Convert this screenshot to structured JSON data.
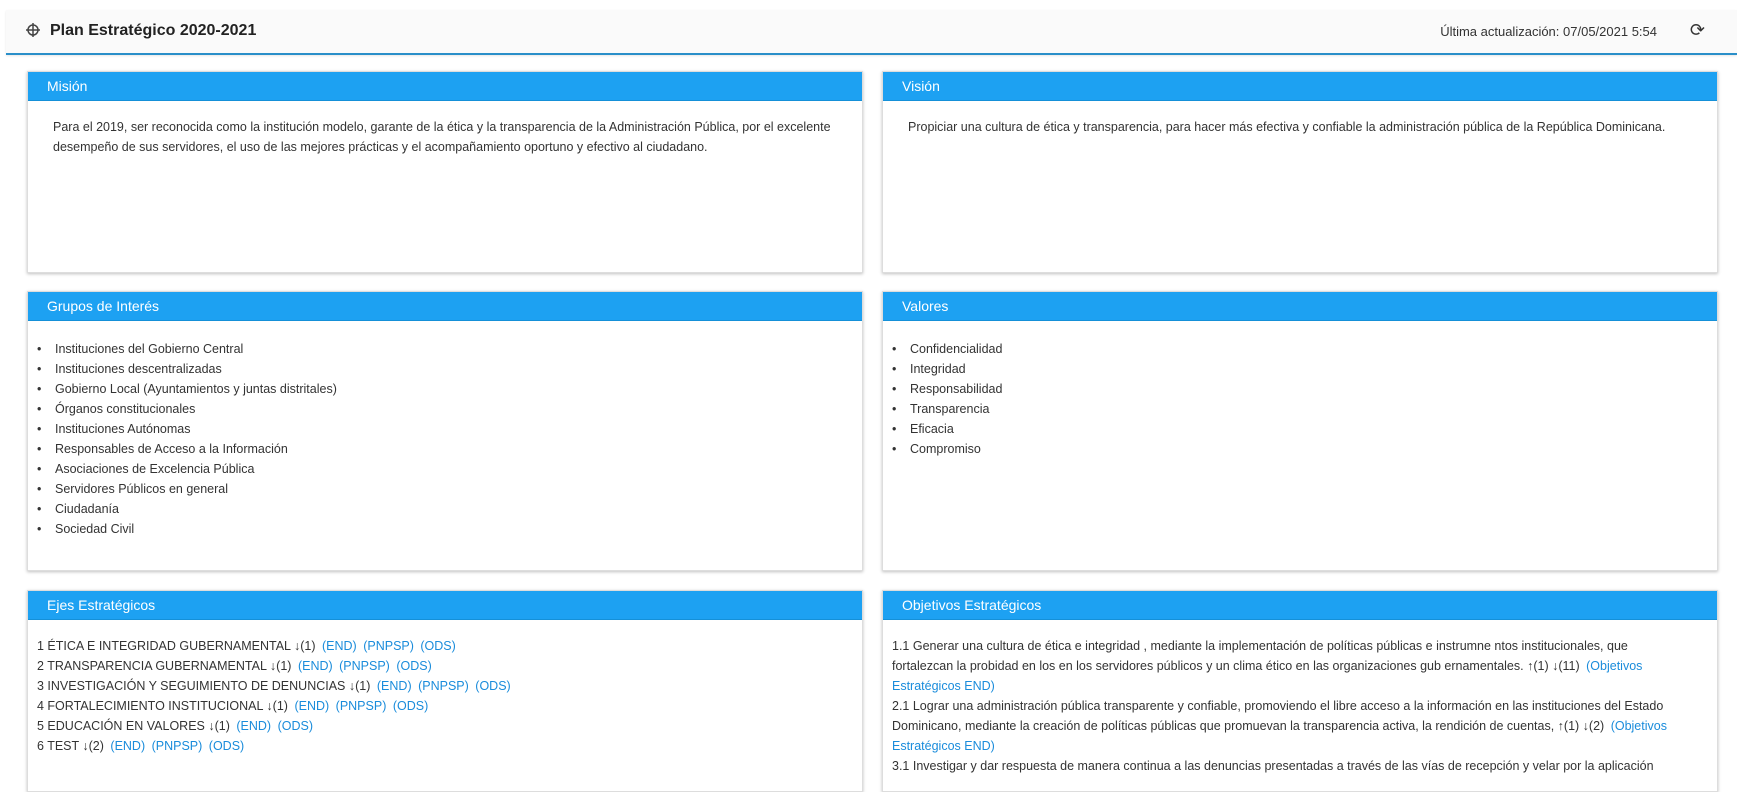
{
  "header": {
    "title": "Plan Estratégico 2020-2021",
    "updated_label": "Última actualización: 07/05/2021 5:54",
    "icon": "crosshair-icon",
    "refresh_icon": "refresh-icon"
  },
  "mision": {
    "title": "Misión",
    "text": "Para el 2019, ser reconocida como la institución modelo, garante de la ética y la transparencia de la Administración Pública, por el excelente desempeño de sus servidores, el uso de las mejores prácticas y el acompañamiento oportuno y efectivo al ciudadano."
  },
  "vision": {
    "title": "Visión",
    "text": "Propiciar una cultura de ética y transparencia, para hacer más efectiva y confiable la administración pública de la República Dominicana."
  },
  "grupos": {
    "title": "Grupos de Interés",
    "items": [
      "Instituciones del Gobierno Central",
      "Instituciones descentralizadas",
      "Gobierno Local (Ayuntamientos y juntas distritales)",
      "Órganos constitucionales",
      "Instituciones Autónomas",
      "Responsables de Acceso a la Información",
      "Asociaciones de Excelencia Pública",
      "Servidores Públicos en general",
      "Ciudadanía",
      "Sociedad Civil"
    ]
  },
  "valores": {
    "title": "Valores",
    "items": [
      "Confidencialidad",
      "Integridad",
      "Responsabilidad",
      "Transparencia",
      "Eficacia",
      "Compromiso"
    ]
  },
  "ejes": {
    "title": "Ejes Estratégicos",
    "rows": [
      {
        "text": "1 ÉTICA E INTEGRIDAD GUBERNAMENTAL ↓(1)",
        "links": [
          "(END)",
          "(PNPSP)",
          "(ODS)"
        ]
      },
      {
        "text": "2 TRANSPARENCIA GUBERNAMENTAL ↓(1)",
        "links": [
          "(END)",
          "(PNPSP)",
          "(ODS)"
        ]
      },
      {
        "text": "3 INVESTIGACIÓN Y SEGUIMIENTO DE DENUNCIAS ↓(1)",
        "links": [
          "(END)",
          "(PNPSP)",
          "(ODS)"
        ]
      },
      {
        "text": "4 FORTALECIMIENTO INSTITUCIONAL ↓(1)",
        "links": [
          "(END)",
          "(PNPSP)",
          "(ODS)"
        ]
      },
      {
        "text": "5 EDUCACIÓN EN VALORES ↓(1)",
        "links": [
          "(END)",
          "(ODS)"
        ]
      },
      {
        "text": "6 TEST ↓(2)",
        "links": [
          "(END)",
          "(PNPSP)",
          "(ODS)"
        ]
      }
    ]
  },
  "objetivos": {
    "title": "Objetivos Estratégicos",
    "items": [
      {
        "text": "1.1 Generar una cultura de ética e integridad , mediante la implementación de políticas públicas e instrumne ntos institucionales, que fortalezcan la probidad en los en los servidores públicos y un clima ético en las organizaciones gub ernamentales. ↑(1) ↓(11)",
        "link": "(Objetivos Estratégicos END)"
      },
      {
        "text": "2.1 Lograr una administración pública transparente y confiable, promoviendo el libre acceso a la información en las instituciones del Estado Dominicano, mediante la creación de políticas públicas que promuevan la transparencia activa, la rendición de cuentas, ↑(1) ↓(2)",
        "link": "(Objetivos Estratégicos END)"
      },
      {
        "text": "3.1 Investigar y dar respuesta de manera continua a las denuncias presentadas a través de las vías de recepción y velar por la aplicación",
        "link": ""
      }
    ]
  },
  "colors": {
    "accent": "#1da1f2",
    "link": "#1a8cdb",
    "header_border": "#2a8fc9"
  }
}
